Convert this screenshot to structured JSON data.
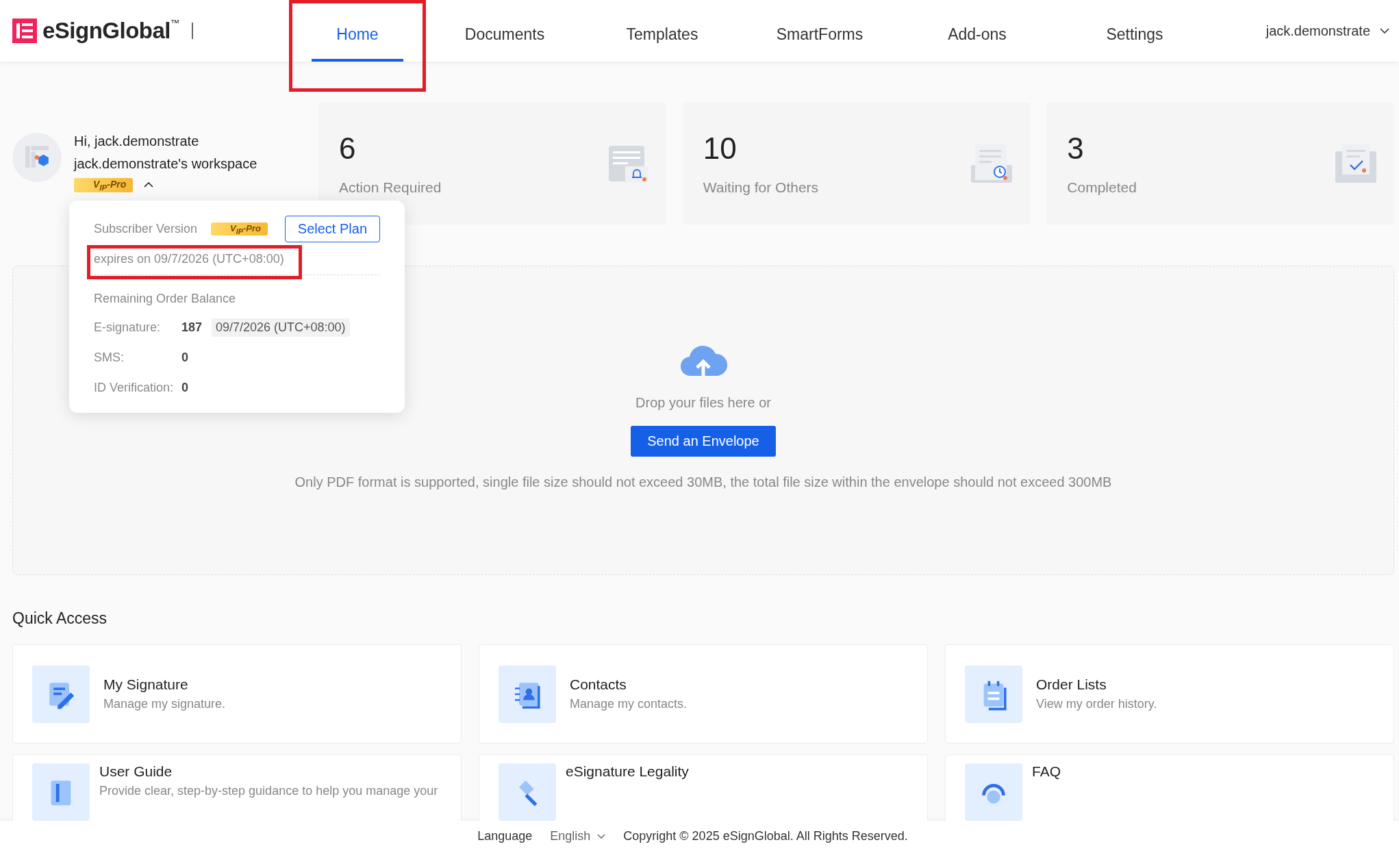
{
  "brand": {
    "name": "eSignGlobal",
    "mark": "™"
  },
  "nav": [
    {
      "label": "Home",
      "selected": true,
      "highlighted": true
    },
    {
      "label": "Documents",
      "selected": false,
      "highlighted": false
    },
    {
      "label": "Templates",
      "selected": false,
      "highlighted": false
    },
    {
      "label": "SmartForms",
      "selected": false,
      "highlighted": false
    },
    {
      "label": "Add-ons",
      "selected": false,
      "highlighted": false
    },
    {
      "label": "Settings",
      "selected": false,
      "highlighted": false
    }
  ],
  "user_menu": {
    "label": "jack.demonstrate"
  },
  "profile": {
    "greeting": "Hi, jack.demonstrate",
    "workspace": "jack.demonstrate's workspace",
    "badge": "V$_{IP}$-Pro",
    "expanded": true
  },
  "popup": {
    "subscriber_label": "Subscriber Version",
    "badge": "V$_{IP}$-Pro",
    "button": "Select Plan",
    "expires": "expires on 09/7/2026 (UTC+08:00)",
    "expires_highlighted": true,
    "balance_title": "Remaining Order Balance",
    "rows": [
      {
        "label": "E-signature:",
        "value": "187",
        "date": "09/7/2026 (UTC+08:00)"
      },
      {
        "label": "SMS:",
        "value": "0"
      },
      {
        "label": "ID Verification:",
        "value": "0"
      }
    ]
  },
  "stats": [
    {
      "value": "6",
      "label": "Action Required",
      "kind": "action"
    },
    {
      "value": "10",
      "label": "Waiting for Others",
      "kind": "waiting"
    },
    {
      "value": "3",
      "label": "Completed",
      "kind": "completed"
    }
  ],
  "upload": {
    "hint": "Drop your files here or",
    "button": "Send an Envelope",
    "note": "Only PDF format is supported, single file size should not exceed 30MB, the total file size within the envelope should not exceed 300MB"
  },
  "quick_access": {
    "title": "Quick Access",
    "items": [
      {
        "title": "My Signature",
        "description": "Manage my signature.",
        "kind": "signature"
      },
      {
        "title": "Contacts",
        "description": "Manage my contacts.",
        "kind": "contacts"
      },
      {
        "title": "Order Lists",
        "description": "View my order history.",
        "kind": "orders"
      },
      {
        "title": "User Guide",
        "description": "Provide clear, step-by-step guidance to help you manage your",
        "kind": "guide"
      },
      {
        "title": "eSignature Legality",
        "kind": "legal"
      },
      {
        "title": "FAQ",
        "kind": "faq"
      }
    ]
  },
  "footer": {
    "language_label": "Language",
    "language": "English",
    "copyright": "Copyright © 2025 eSignGlobal. All Rights Reserved."
  }
}
